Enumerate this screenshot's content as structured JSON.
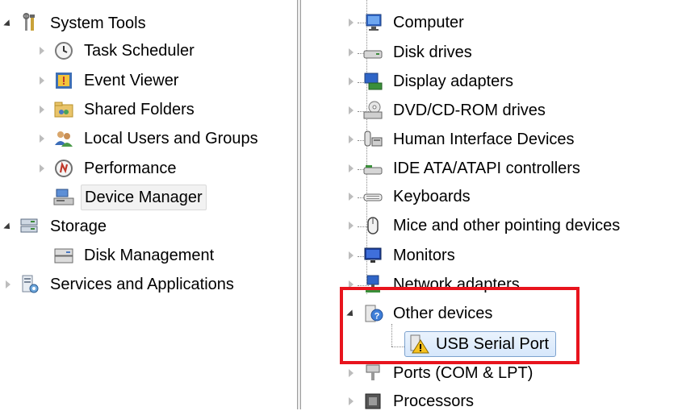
{
  "left_tree": {
    "items": [
      {
        "label": "System Tools",
        "icon": "system-tools-icon"
      },
      {
        "label": "Task Scheduler",
        "icon": "clock-icon"
      },
      {
        "label": "Event Viewer",
        "icon": "event-viewer-icon"
      },
      {
        "label": "Shared Folders",
        "icon": "shared-folders-icon"
      },
      {
        "label": "Local Users and Groups",
        "icon": "users-icon"
      },
      {
        "label": "Performance",
        "icon": "performance-icon"
      },
      {
        "label": "Device Manager",
        "icon": "device-manager-icon"
      },
      {
        "label": "Storage",
        "icon": "storage-icon"
      },
      {
        "label": "Disk Management",
        "icon": "disk-management-icon"
      },
      {
        "label": "Services and Applications",
        "icon": "services-icon"
      }
    ]
  },
  "right_tree": {
    "items": [
      {
        "label": "Computer",
        "icon": "computer-icon"
      },
      {
        "label": "Disk drives",
        "icon": "disk-drive-icon"
      },
      {
        "label": "Display adapters",
        "icon": "display-adapter-icon"
      },
      {
        "label": "DVD/CD-ROM drives",
        "icon": "dvd-icon"
      },
      {
        "label": "Human Interface Devices",
        "icon": "hid-icon"
      },
      {
        "label": "IDE ATA/ATAPI controllers",
        "icon": "ide-icon"
      },
      {
        "label": "Keyboards",
        "icon": "keyboard-icon"
      },
      {
        "label": "Mice and other pointing devices",
        "icon": "mouse-icon"
      },
      {
        "label": "Monitors",
        "icon": "monitor-icon"
      },
      {
        "label": "Network adapters",
        "icon": "network-icon"
      },
      {
        "label": "Other devices",
        "icon": "unknown-device-icon"
      },
      {
        "label": "USB Serial Port",
        "icon": "warning-device-icon"
      },
      {
        "label": "Ports (COM & LPT)",
        "icon": "port-icon"
      },
      {
        "label": "Processors",
        "icon": "processor-icon"
      }
    ]
  },
  "colors": {
    "highlight": "#e8141d",
    "selection": "#d6e7fb"
  }
}
